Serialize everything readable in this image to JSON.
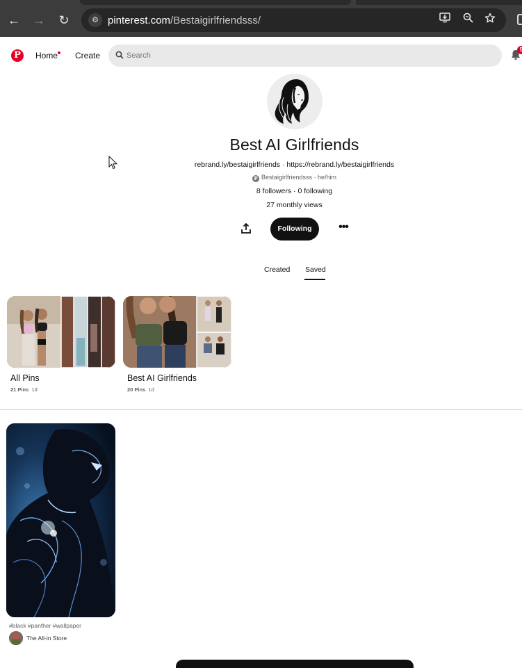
{
  "browser": {
    "url_domain": "pinterest.com",
    "url_path": "/Bestaigirlfriendsss/",
    "icons": [
      "back-icon",
      "forward-icon",
      "reload-icon",
      "site-info-icon",
      "install-icon",
      "zoom-icon",
      "bookmark-star-icon"
    ]
  },
  "header": {
    "home_label": "Home",
    "create_label": "Create",
    "search_placeholder": "Search",
    "notifications_badge": "5",
    "accent_color": "#e60023"
  },
  "profile": {
    "name": "Best AI Girlfriends",
    "link_text": "rebrand.ly/bestaigirlfriends",
    "link_url_text": "https://rebrand.ly/bestaigirlfriends",
    "handle": "Bestaigirlfriendsss",
    "pronouns": "he/him",
    "followers": "8 followers",
    "following_count": "0 following",
    "monthly_views": "27 monthly views",
    "following_button": "Following"
  },
  "tabs": {
    "created": "Created",
    "saved": "Saved",
    "active": "saved"
  },
  "boards": [
    {
      "title": "All Pins",
      "pins": "21 Pins",
      "age": "1d"
    },
    {
      "title": "Best AI Girlfriends",
      "pins": "20 Pins",
      "age": "1d"
    }
  ],
  "pins": [
    {
      "description": "#black #panther #wallpaper",
      "author": "The All-in Store"
    }
  ]
}
